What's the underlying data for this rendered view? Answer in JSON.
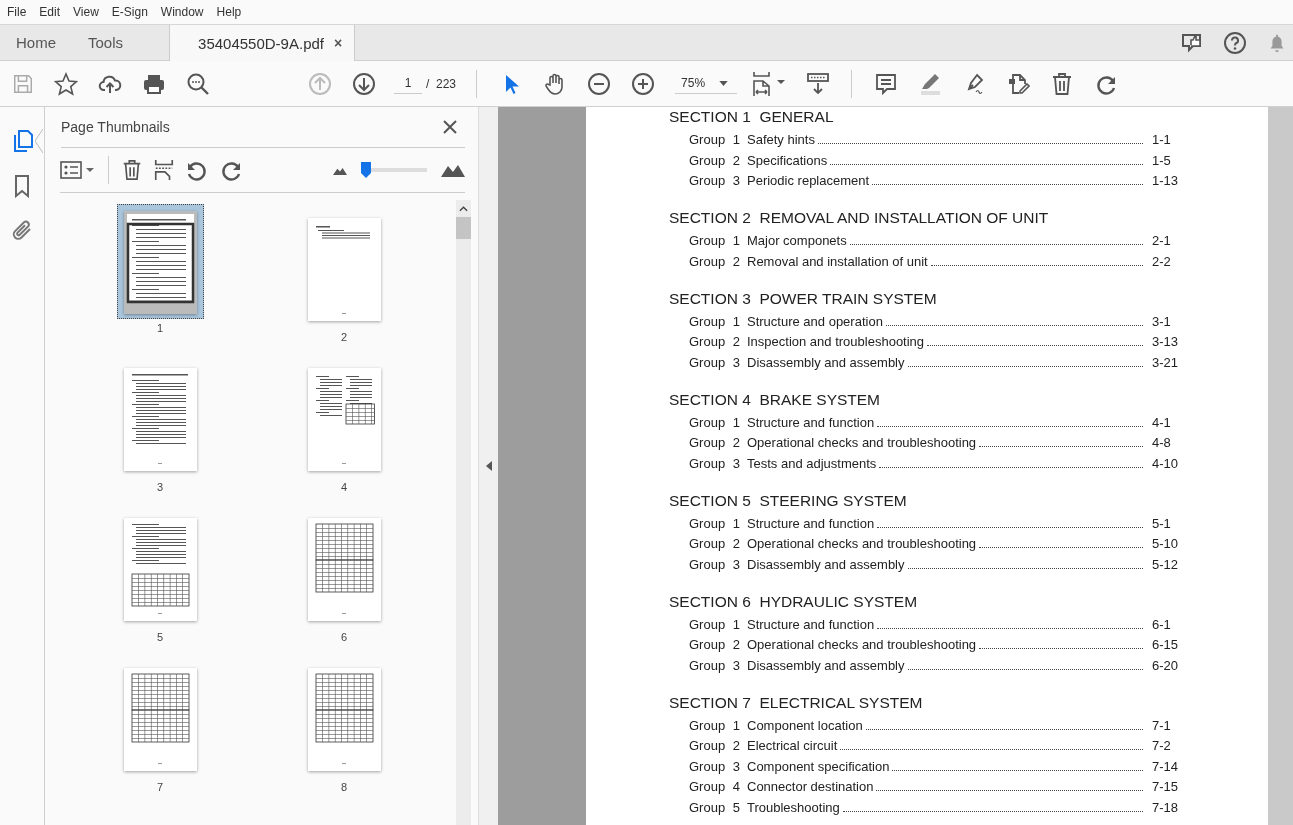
{
  "menu": [
    "File",
    "Edit",
    "View",
    "E-Sign",
    "Window",
    "Help"
  ],
  "tabs": [
    {
      "label": "Home",
      "selected": false
    },
    {
      "label": "Tools",
      "selected": false
    },
    {
      "label": "35404550D-9A.pdf",
      "selected": true,
      "close": "×"
    }
  ],
  "toolbar": {
    "page_current": "1",
    "page_separator": "/",
    "page_total": "223",
    "zoom": "75%"
  },
  "side_rail": [
    {
      "kind": "pages",
      "selected": true
    },
    {
      "kind": "bookmarks",
      "selected": false
    },
    {
      "kind": "attachments",
      "selected": false
    }
  ],
  "panel": {
    "title": "Page Thumbnails",
    "size_slider": {
      "level": 0.08
    },
    "thumbnails": [
      {
        "label": "1",
        "kind": "contents",
        "selected": true
      },
      {
        "label": "2",
        "kind": "brief",
        "selected": false
      },
      {
        "label": "3",
        "kind": "text",
        "selected": false
      },
      {
        "label": "4",
        "kind": "mixed",
        "selected": false
      },
      {
        "label": "5",
        "kind": "textTable",
        "selected": false
      },
      {
        "label": "6",
        "kind": "tables",
        "selected": false
      },
      {
        "label": "7",
        "kind": "tables",
        "selected": false
      },
      {
        "label": "8",
        "kind": "tables",
        "selected": false
      }
    ]
  },
  "document": {
    "sections": [
      {
        "heading": "SECTION 1  GENERAL",
        "groups": [
          {
            "label": "Group",
            "number": "1",
            "title": "Safety hints",
            "page": "1-1"
          },
          {
            "label": "Group",
            "number": "2",
            "title": "Specifications",
            "page": "1-5"
          },
          {
            "label": "Group",
            "number": "3",
            "title": "Periodic replacement",
            "page": "1-13"
          }
        ]
      },
      {
        "heading": "SECTION 2  REMOVAL AND INSTALLATION OF UNIT",
        "groups": [
          {
            "label": "Group",
            "number": "1",
            "title": "Major componets",
            "page": "2-1"
          },
          {
            "label": "Group",
            "number": "2",
            "title": "Removal and installation of unit",
            "page": "2-2"
          }
        ]
      },
      {
        "heading": "SECTION 3  POWER TRAIN SYSTEM",
        "groups": [
          {
            "label": "Group",
            "number": "1",
            "title": "Structure and operation",
            "page": "3-1"
          },
          {
            "label": "Group",
            "number": "2",
            "title": "Inspection and troubleshooting",
            "page": "3-13"
          },
          {
            "label": "Group",
            "number": "3",
            "title": "Disassembly and assembly",
            "page": "3-21"
          }
        ]
      },
      {
        "heading": "SECTION 4  BRAKE SYSTEM",
        "groups": [
          {
            "label": "Group",
            "number": "1",
            "title": "Structure and function",
            "page": "4-1"
          },
          {
            "label": "Group",
            "number": "2",
            "title": "Operational checks and troubleshooting",
            "page": "4-8"
          },
          {
            "label": "Group",
            "number": "3",
            "title": "Tests and adjustments",
            "page": "4-10"
          }
        ]
      },
      {
        "heading": "SECTION 5  STEERING SYSTEM",
        "groups": [
          {
            "label": "Group",
            "number": "1",
            "title": "Structure and function",
            "page": "5-1"
          },
          {
            "label": "Group",
            "number": "2",
            "title": "Operational checks and troubleshooting",
            "page": "5-10"
          },
          {
            "label": "Group",
            "number": "3",
            "title": "Disassembly and assembly",
            "page": "5-12"
          }
        ]
      },
      {
        "heading": "SECTION 6  HYDRAULIC SYSTEM",
        "groups": [
          {
            "label": "Group",
            "number": "1",
            "title": "Structure and function",
            "page": "6-1"
          },
          {
            "label": "Group",
            "number": "2",
            "title": "Operational checks and troubleshooting",
            "page": "6-15"
          },
          {
            "label": "Group",
            "number": "3",
            "title": "Disassembly and assembly",
            "page": "6-20"
          }
        ]
      },
      {
        "heading": "SECTION 7  ELECTRICAL SYSTEM",
        "groups": [
          {
            "label": "Group",
            "number": "1",
            "title": "Component location",
            "page": "7-1"
          },
          {
            "label": "Group",
            "number": "2",
            "title": "Electrical circuit",
            "page": "7-2"
          },
          {
            "label": "Group",
            "number": "3",
            "title": "Component specification",
            "page": "7-14"
          },
          {
            "label": "Group",
            "number": "4",
            "title": "Connector destination",
            "page": "7-15"
          },
          {
            "label": "Group",
            "number": "5",
            "title": "Troubleshooting",
            "page": "7-18"
          }
        ]
      }
    ]
  }
}
